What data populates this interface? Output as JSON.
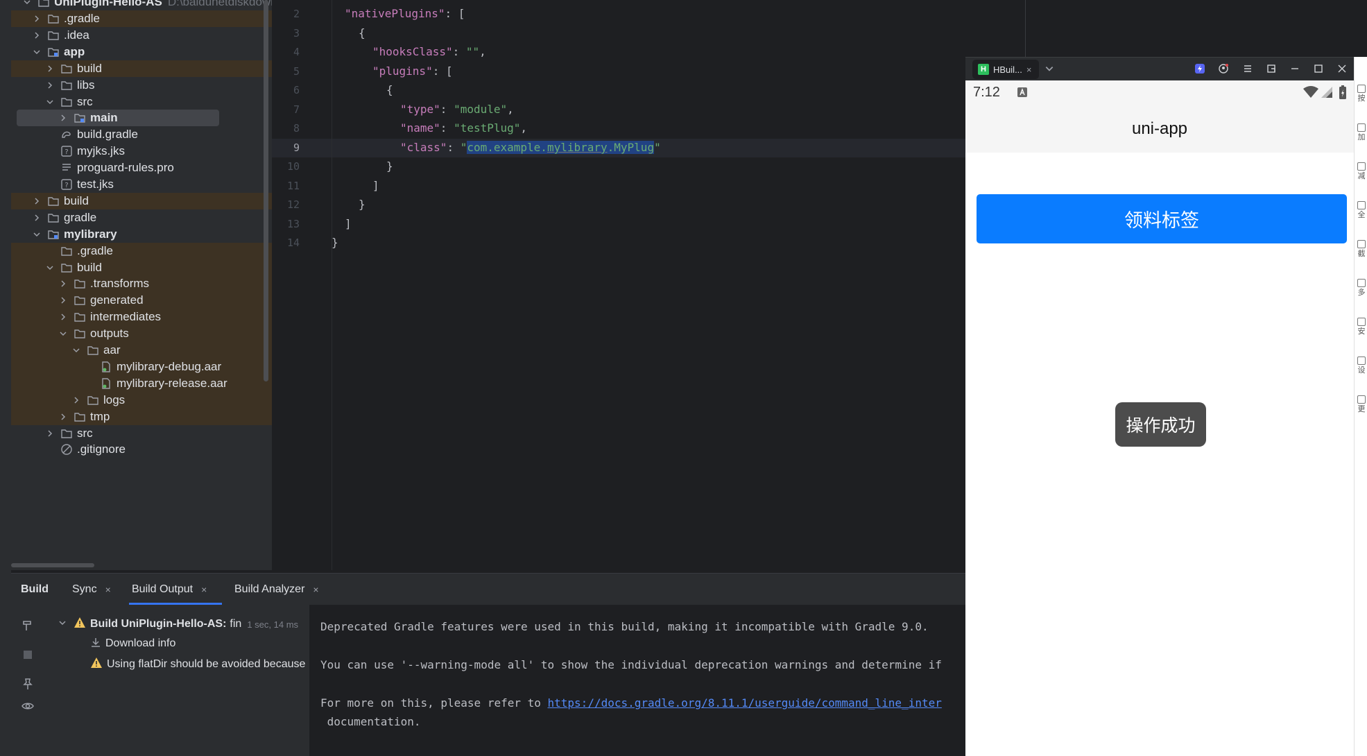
{
  "project": {
    "root_label": "UniPlugin-Hello-AS",
    "root_path": "D:\\baidunetdiskdown",
    "items": [
      {
        "label": ".gradle"
      },
      {
        "label": ".idea"
      },
      {
        "label": "app"
      },
      {
        "label": "build"
      },
      {
        "label": "libs"
      },
      {
        "label": "src"
      },
      {
        "label": "main"
      },
      {
        "label": "build.gradle"
      },
      {
        "label": "myjks.jks"
      },
      {
        "label": "proguard-rules.pro"
      },
      {
        "label": "test.jks"
      },
      {
        "label": "build"
      },
      {
        "label": "gradle"
      },
      {
        "label": "mylibrary"
      },
      {
        "label": ".gradle"
      },
      {
        "label": "build"
      },
      {
        "label": ".transforms"
      },
      {
        "label": "generated"
      },
      {
        "label": "intermediates"
      },
      {
        "label": "outputs"
      },
      {
        "label": "aar"
      },
      {
        "label": "mylibrary-debug.aar"
      },
      {
        "label": "mylibrary-release.aar"
      },
      {
        "label": "logs"
      },
      {
        "label": "tmp"
      },
      {
        "label": "src"
      },
      {
        "label": ".gitignore"
      }
    ]
  },
  "editor": {
    "line_numbers": [
      "2",
      "3",
      "4",
      "5",
      "6",
      "7",
      "8",
      "9",
      "10",
      "11",
      "12",
      "13",
      "14"
    ],
    "code": {
      "l2_key": "\"nativePlugins\"",
      "l2_rest": ": [",
      "l3": "{",
      "l4_key": "\"hooksClass\"",
      "l4_sep": ": ",
      "l4_val": "\"\"",
      "l4_end": ",",
      "l5_key": "\"plugins\"",
      "l5_rest": ": [",
      "l6": "{",
      "l7_key": "\"type\"",
      "l7_sep": ": ",
      "l7_val": "\"module\"",
      "l7_end": ",",
      "l8_key": "\"name\"",
      "l8_sep": ": ",
      "l8_val": "\"testPlug\"",
      "l8_end": ",",
      "l9_key": "\"class\"",
      "l9_sep": ": ",
      "l9_q1": "\"",
      "l9_a": "com.example.",
      "l9_b": "mylibrary",
      "l9_c": ".MyPlug",
      "l9_q2": "\"",
      "l10": "}",
      "l11": "]",
      "l12": "}",
      "l13": "]",
      "l14": "}"
    }
  },
  "build_panel": {
    "tabs": {
      "build": "Build",
      "sync": "Sync",
      "output": "Build Output",
      "analyzer": "Build Analyzer"
    },
    "close_glyph": "×",
    "tree": {
      "root": "Build UniPlugin-Hello-AS:",
      "root_status": "fin",
      "root_time": "1 sec, 14 ms",
      "download": "Download info",
      "warning": "Using flatDir should be avoided because"
    },
    "output": {
      "line1": "Deprecated Gradle features were used in this build, making it incompatible with Gradle 9.0.",
      "line2": "You can use '--warning-mode all' to show the individual deprecation warnings and determine if",
      "line3_prefix": "For more on this, please refer to ",
      "line3_link": "https://docs.gradle.org/8.11.1/userguide/command_line_inter",
      "line4": " documentation."
    }
  },
  "phone": {
    "tab_title": "HBuil...",
    "time": "7:12",
    "nav_title": "uni-app",
    "button_label": "领料标签",
    "toast": "操作成功"
  },
  "right_sidebar": {
    "labels": [
      "按",
      "加",
      "减",
      "全",
      "截",
      "多",
      "安",
      "设",
      "更"
    ]
  },
  "colors": {
    "accent": "#3574f0",
    "button": "#0a7cff",
    "warning": "#f2c55c"
  }
}
